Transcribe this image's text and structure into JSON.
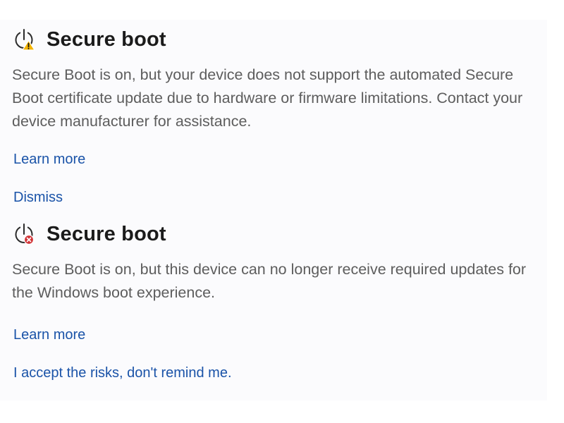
{
  "notices": [
    {
      "title": "Secure boot",
      "status_icon": "power-warning-icon",
      "status_color": "#f4b400",
      "description": "Secure Boot is on, but your device does not support the automated Secure Boot certificate update due to hardware or firmware limitations. Contact your device manufacturer for assistance.",
      "link_primary": "Learn more",
      "link_secondary": "Dismiss"
    },
    {
      "title": "Secure boot",
      "status_icon": "power-error-icon",
      "status_color": "#d13438",
      "description": "Secure Boot is on, but this device can no longer receive required updates for the Windows boot experience.",
      "link_primary": "Learn more",
      "link_secondary": "I accept the risks, don't remind me."
    }
  ],
  "colors": {
    "link": "#1a53a8",
    "title": "#1b1b1b",
    "text": "#5d5d5d",
    "background": "#fbfbfd"
  }
}
